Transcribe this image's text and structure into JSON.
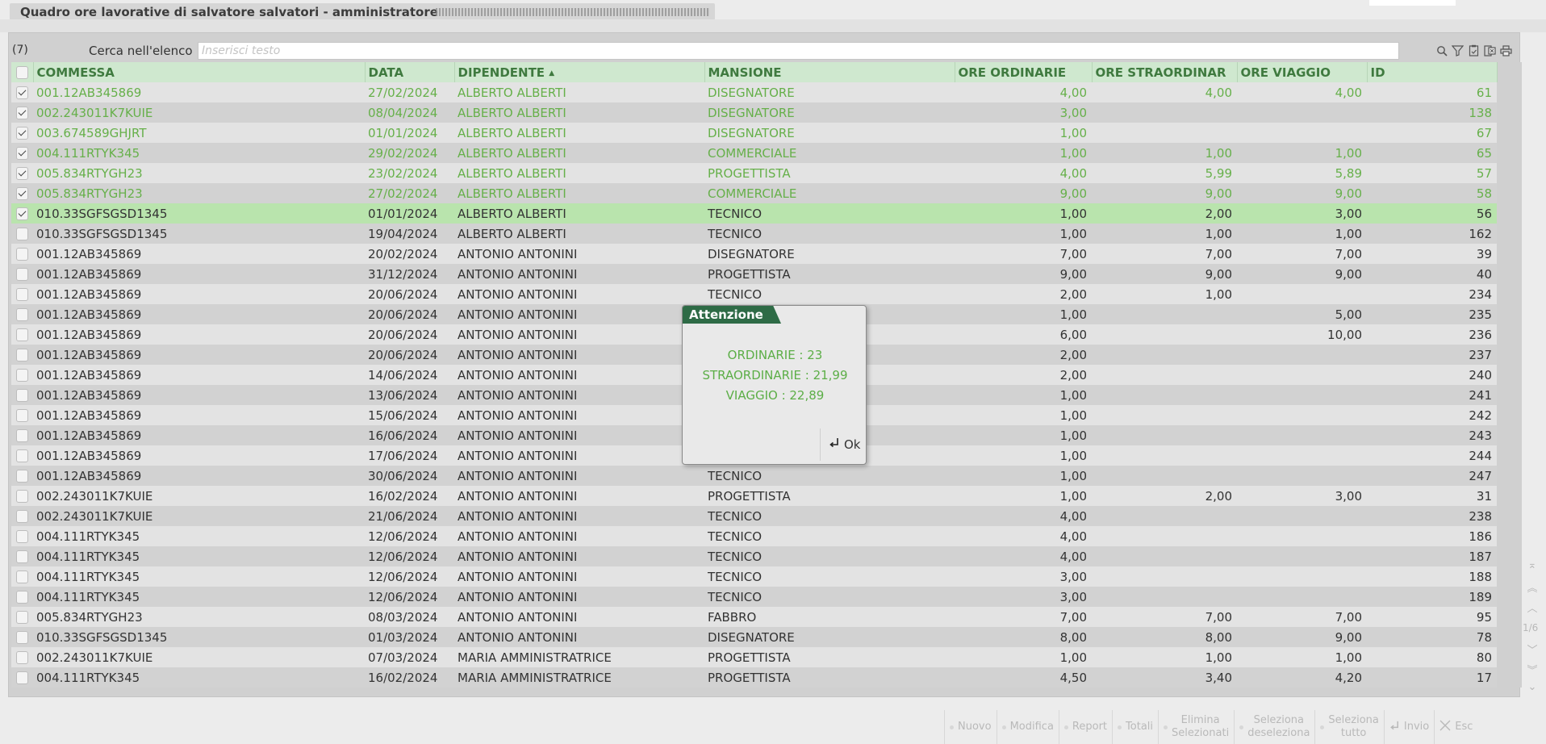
{
  "window": {
    "title": "Quadro ore lavorative di salvatore salvatori - amministratore"
  },
  "list": {
    "count": "(7)",
    "search_label": "Cerca nell'elenco",
    "search_placeholder": "Inserisci testo",
    "tools": [
      "search-icon",
      "filter-icon",
      "clipboard-icon",
      "export-icon",
      "print-icon"
    ]
  },
  "columns": [
    "COMMESSA",
    "DATA",
    "DIPENDENTE",
    "MANSIONE",
    "ORE ORDINARIE",
    "ORE STRAORDINAR",
    "ORE VIAGGIO",
    "ID"
  ],
  "sort_indicator": "▲",
  "rows": [
    {
      "checked": true,
      "state": "sel",
      "c": [
        "001.12AB345869",
        "27/02/2024",
        "ALBERTO ALBERTI",
        "DISEGNATORE",
        "4,00",
        "4,00",
        "4,00",
        "61"
      ]
    },
    {
      "checked": true,
      "state": "sel",
      "c": [
        "002.243011K7KUIE",
        "08/04/2024",
        "ALBERTO ALBERTI",
        "DISEGNATORE",
        "3,00",
        "",
        "",
        "138"
      ]
    },
    {
      "checked": true,
      "state": "sel",
      "c": [
        "003.674589GHJRT",
        "01/01/2024",
        "ALBERTO ALBERTI",
        "DISEGNATORE",
        "1,00",
        "",
        "",
        "67"
      ]
    },
    {
      "checked": true,
      "state": "sel",
      "c": [
        "004.111RTYK345",
        "29/02/2024",
        "ALBERTO ALBERTI",
        "COMMERCIALE",
        "1,00",
        "1,00",
        "1,00",
        "65"
      ]
    },
    {
      "checked": true,
      "state": "sel",
      "c": [
        "005.834RTYGH23",
        "23/02/2024",
        "ALBERTO ALBERTI",
        "PROGETTISTA",
        "4,00",
        "5,99",
        "5,89",
        "57"
      ]
    },
    {
      "checked": true,
      "state": "sel",
      "c": [
        "005.834RTYGH23",
        "27/02/2024",
        "ALBERTO ALBERTI",
        "COMMERCIALE",
        "9,00",
        "9,00",
        "9,00",
        "58"
      ]
    },
    {
      "checked": true,
      "state": "cur",
      "c": [
        "010.33SGFSGSD1345",
        "01/01/2024",
        "ALBERTO ALBERTI",
        "TECNICO",
        "1,00",
        "2,00",
        "3,00",
        "56"
      ]
    },
    {
      "checked": false,
      "state": "",
      "c": [
        "010.33SGFSGSD1345",
        "19/04/2024",
        "ALBERTO ALBERTI",
        "TECNICO",
        "1,00",
        "1,00",
        "1,00",
        "162"
      ]
    },
    {
      "checked": false,
      "state": "",
      "c": [
        "001.12AB345869",
        "20/02/2024",
        "ANTONIO ANTONINI",
        "DISEGNATORE",
        "7,00",
        "7,00",
        "7,00",
        "39"
      ]
    },
    {
      "checked": false,
      "state": "",
      "c": [
        "001.12AB345869",
        "31/12/2024",
        "ANTONIO ANTONINI",
        "PROGETTISTA",
        "9,00",
        "9,00",
        "9,00",
        "40"
      ]
    },
    {
      "checked": false,
      "state": "",
      "c": [
        "001.12AB345869",
        "20/06/2024",
        "ANTONIO ANTONINI",
        "TECNICO",
        "2,00",
        "1,00",
        "",
        "234"
      ]
    },
    {
      "checked": false,
      "state": "",
      "c": [
        "001.12AB345869",
        "20/06/2024",
        "ANTONIO ANTONINI",
        "",
        "1,00",
        "",
        "5,00",
        "235"
      ]
    },
    {
      "checked": false,
      "state": "",
      "c": [
        "001.12AB345869",
        "20/06/2024",
        "ANTONIO ANTONINI",
        "",
        "6,00",
        "",
        "10,00",
        "236"
      ]
    },
    {
      "checked": false,
      "state": "",
      "c": [
        "001.12AB345869",
        "20/06/2024",
        "ANTONIO ANTONINI",
        "",
        "2,00",
        "",
        "",
        "237"
      ]
    },
    {
      "checked": false,
      "state": "",
      "c": [
        "001.12AB345869",
        "14/06/2024",
        "ANTONIO ANTONINI",
        "",
        "2,00",
        "",
        "",
        "240"
      ]
    },
    {
      "checked": false,
      "state": "",
      "c": [
        "001.12AB345869",
        "13/06/2024",
        "ANTONIO ANTONINI",
        "",
        "1,00",
        "",
        "",
        "241"
      ]
    },
    {
      "checked": false,
      "state": "",
      "c": [
        "001.12AB345869",
        "15/06/2024",
        "ANTONIO ANTONINI",
        "",
        "1,00",
        "",
        "",
        "242"
      ]
    },
    {
      "checked": false,
      "state": "",
      "c": [
        "001.12AB345869",
        "16/06/2024",
        "ANTONIO ANTONINI",
        "",
        "1,00",
        "",
        "",
        "243"
      ]
    },
    {
      "checked": false,
      "state": "",
      "c": [
        "001.12AB345869",
        "17/06/2024",
        "ANTONIO ANTONINI",
        "",
        "1,00",
        "",
        "",
        "244"
      ]
    },
    {
      "checked": false,
      "state": "",
      "c": [
        "001.12AB345869",
        "30/06/2024",
        "ANTONIO ANTONINI",
        "TECNICO",
        "1,00",
        "",
        "",
        "247"
      ]
    },
    {
      "checked": false,
      "state": "",
      "c": [
        "002.243011K7KUIE",
        "16/02/2024",
        "ANTONIO ANTONINI",
        "PROGETTISTA",
        "1,00",
        "2,00",
        "3,00",
        "31"
      ]
    },
    {
      "checked": false,
      "state": "",
      "c": [
        "002.243011K7KUIE",
        "21/06/2024",
        "ANTONIO ANTONINI",
        "TECNICO",
        "4,00",
        "",
        "",
        "238"
      ]
    },
    {
      "checked": false,
      "state": "",
      "c": [
        "004.111RTYK345",
        "12/06/2024",
        "ANTONIO ANTONINI",
        "TECNICO",
        "4,00",
        "",
        "",
        "186"
      ]
    },
    {
      "checked": false,
      "state": "",
      "c": [
        "004.111RTYK345",
        "12/06/2024",
        "ANTONIO ANTONINI",
        "TECNICO",
        "4,00",
        "",
        "",
        "187"
      ]
    },
    {
      "checked": false,
      "state": "",
      "c": [
        "004.111RTYK345",
        "12/06/2024",
        "ANTONIO ANTONINI",
        "TECNICO",
        "3,00",
        "",
        "",
        "188"
      ]
    },
    {
      "checked": false,
      "state": "",
      "c": [
        "004.111RTYK345",
        "12/06/2024",
        "ANTONIO ANTONINI",
        "TECNICO",
        "3,00",
        "",
        "",
        "189"
      ]
    },
    {
      "checked": false,
      "state": "",
      "c": [
        "005.834RTYGH23",
        "08/03/2024",
        "ANTONIO ANTONINI",
        "FABBRO",
        "7,00",
        "7,00",
        "7,00",
        "95"
      ]
    },
    {
      "checked": false,
      "state": "",
      "c": [
        "010.33SGFSGSD1345",
        "01/03/2024",
        "ANTONIO ANTONINI",
        "DISEGNATORE",
        "8,00",
        "8,00",
        "9,00",
        "78"
      ]
    },
    {
      "checked": false,
      "state": "",
      "c": [
        "002.243011K7KUIE",
        "07/03/2024",
        "MARIA AMMINISTRATRICE",
        "PROGETTISTA",
        "1,00",
        "1,00",
        "1,00",
        "80"
      ]
    },
    {
      "checked": false,
      "state": "",
      "c": [
        "004.111RTYK345",
        "16/02/2024",
        "MARIA AMMINISTRATRICE",
        "PROGETTISTA",
        "4,50",
        "3,40",
        "4,20",
        "17"
      ]
    }
  ],
  "pager": {
    "page": "1/6"
  },
  "dialog": {
    "title": "Attenzione",
    "lines": [
      "ORDINARIE : 23",
      "STRAORDINARIE : 21,99",
      "VIAGGIO : 22,89"
    ],
    "ok_label": "Ok"
  },
  "toolbar": {
    "nuovo": "Nuovo",
    "modifica": "Modifica",
    "report": "Report",
    "totali": "Totali",
    "elimina": [
      "Elimina",
      "Selezionati"
    ],
    "seleziona_deseleziona": [
      "Seleziona",
      "deseleziona"
    ],
    "seleziona_tutto": [
      "Seleziona",
      "tutto"
    ],
    "invio": "Invio",
    "esc": "Esc"
  },
  "colors": {
    "header_bg": "#cfe8cf",
    "header_text": "#3f7a3f",
    "selected_text": "#66b04a",
    "current_row": "#b9e4ad",
    "dialog_title": "#2e6b46"
  }
}
